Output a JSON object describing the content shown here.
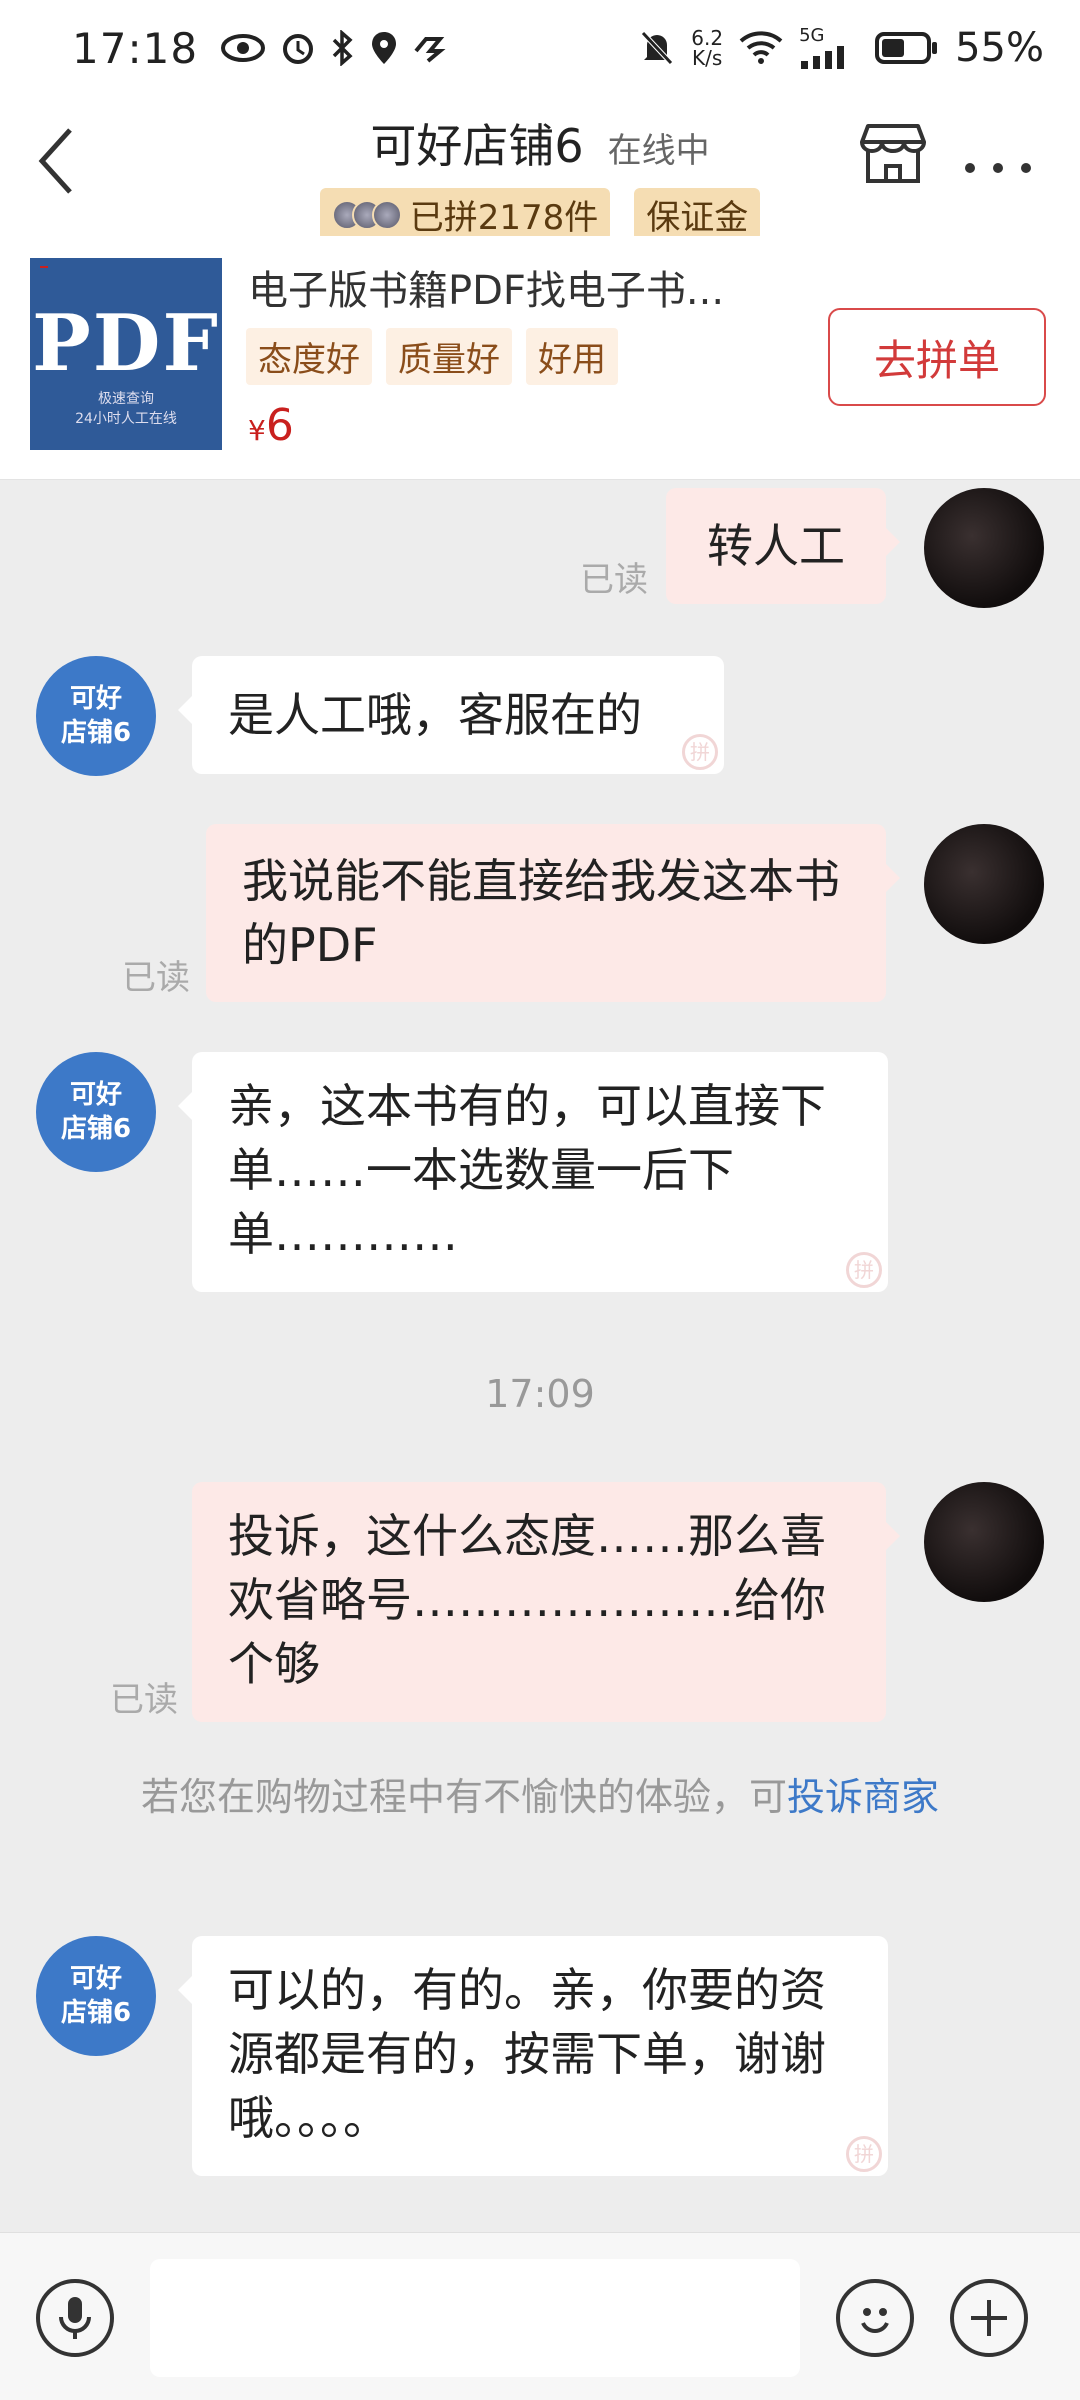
{
  "status_bar": {
    "time": "17:18",
    "net_speed_value": "6.2",
    "net_speed_unit": "K/s",
    "net_type": "5G",
    "battery": "55%"
  },
  "header": {
    "shop_name": "可好店铺6",
    "status": "在线中",
    "badge_sold": "已拼2178件",
    "badge_deposit": "保证金"
  },
  "product": {
    "title": "电子版书籍PDF找电子书...",
    "thumb_text": "PDF",
    "thumb_sub1": "极速查询",
    "thumb_sub2": "24小时人工在线",
    "tags": [
      "态度好",
      "质量好",
      "好用"
    ],
    "currency": "¥",
    "price": "6",
    "button": "去拼单"
  },
  "shop_avatar": {
    "line1": "可好",
    "line2": "店铺6"
  },
  "messages": [
    {
      "from": "user",
      "text": "转人工",
      "read": "已读"
    },
    {
      "from": "shop",
      "text": "是人工哦，客服在的"
    },
    {
      "from": "user",
      "text": "我说能不能直接给我发这本书的PDF",
      "read": "已读"
    },
    {
      "from": "shop",
      "text": "亲，这本书有的，可以直接下单……一本选数量一后下单…………"
    },
    {
      "from": "time",
      "text": "17:09"
    },
    {
      "from": "user",
      "text": "投诉，这什么态度……那么喜欢省略号…………………给你个够",
      "read": "已读"
    },
    {
      "from": "notice",
      "text": "若您在购物过程中有不愉快的体验，可",
      "link": "投诉商家"
    },
    {
      "from": "shop",
      "text": "可以的，有的。亲，你要的资源都是有的，按需下单，谢谢哦。。。。"
    }
  ],
  "watermark_char": "拼",
  "icons": {
    "back": "chevron-left-icon",
    "store": "store-icon",
    "more": "more-icon",
    "voice": "microphone-icon",
    "emoji": "emoji-icon",
    "add": "plus-icon"
  }
}
